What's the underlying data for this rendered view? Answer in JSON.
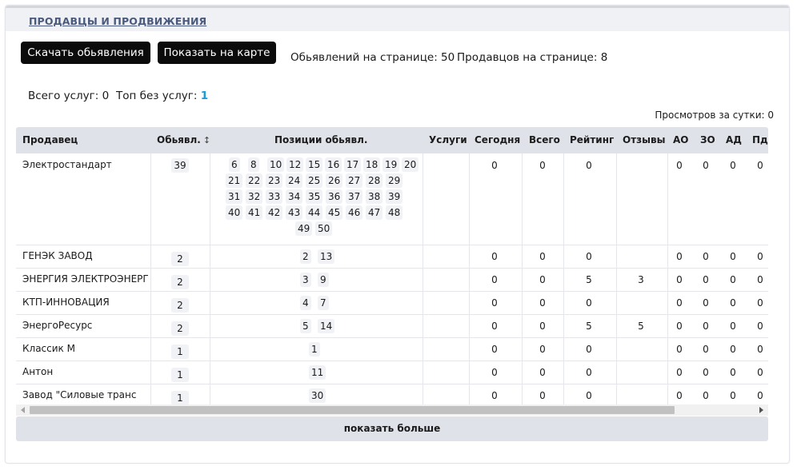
{
  "panel": {
    "title": "ПРОДАВЦЫ И ПРОДВИЖЕНИЯ"
  },
  "toolbar": {
    "download_label": "Скачать обьявления",
    "map_label": "Показать на карте",
    "ads_per_page": "Обьявлений на странице: 50",
    "sellers_per_page": "Продавцов на странице: 8"
  },
  "summary": {
    "total_services_label": "Всего услуг: 0",
    "top_without_label": "Топ без услуг: ",
    "top_without_value": "1",
    "views_per_day": "Просмотров за сутки: 0"
  },
  "table": {
    "columns": [
      "Продавец",
      "Обьявл.",
      "Позиции обьявл.",
      "Услуги",
      "Сегодня",
      "Всего",
      "Рейтинг",
      "Отзывы",
      "АО",
      "ЗО",
      "АД",
      "Пд"
    ],
    "sort_icon": "sort-updown-icon",
    "rows": [
      {
        "seller": "Электростандарт",
        "ads": "39",
        "positions": [
          "6",
          "8",
          "10",
          "12",
          "15",
          "16",
          "17",
          "18",
          "19",
          "20",
          "21",
          "22",
          "23",
          "24",
          "25",
          "26",
          "27",
          "28",
          "29",
          "31",
          "32",
          "33",
          "34",
          "35",
          "36",
          "37",
          "38",
          "39",
          "40",
          "41",
          "42",
          "43",
          "44",
          "45",
          "46",
          "47",
          "48",
          "49",
          "50"
        ],
        "services": "",
        "today": "0",
        "total": "0",
        "rating": "0",
        "reviews": "",
        "ao": "0",
        "zo": "0",
        "ad": "0",
        "pd": "0"
      },
      {
        "seller": "ГЕНЭК ЗАВОД",
        "ads": "2",
        "positions": [
          "2",
          "13"
        ],
        "services": "",
        "today": "0",
        "total": "0",
        "rating": "0",
        "reviews": "",
        "ao": "0",
        "zo": "0",
        "ad": "0",
        "pd": "0"
      },
      {
        "seller": "ЭНЕРГИЯ ЭЛЕКТРОЭНЕРГ",
        "ads": "2",
        "positions": [
          "3",
          "9"
        ],
        "services": "",
        "today": "0",
        "total": "0",
        "rating": "5",
        "reviews": "3",
        "ao": "0",
        "zo": "0",
        "ad": "0",
        "pd": "0"
      },
      {
        "seller": "КТП-ИННОВАЦИЯ",
        "ads": "2",
        "positions": [
          "4",
          "7"
        ],
        "services": "",
        "today": "0",
        "total": "0",
        "rating": "0",
        "reviews": "",
        "ao": "0",
        "zo": "0",
        "ad": "0",
        "pd": "0"
      },
      {
        "seller": "ЭнергоРесурс",
        "ads": "2",
        "positions": [
          "5",
          "14"
        ],
        "services": "",
        "today": "0",
        "total": "0",
        "rating": "5",
        "reviews": "5",
        "ao": "0",
        "zo": "0",
        "ad": "0",
        "pd": "0"
      },
      {
        "seller": "Классик М",
        "ads": "1",
        "positions": [
          "1"
        ],
        "services": "",
        "today": "0",
        "total": "0",
        "rating": "0",
        "reviews": "",
        "ao": "0",
        "zo": "0",
        "ad": "0",
        "pd": "0"
      },
      {
        "seller": "Антон",
        "ads": "1",
        "positions": [
          "11"
        ],
        "services": "",
        "today": "0",
        "total": "0",
        "rating": "0",
        "reviews": "",
        "ao": "0",
        "zo": "0",
        "ad": "0",
        "pd": "0"
      },
      {
        "seller": "Завод \"Силовые транс",
        "ads": "1",
        "positions": [
          "30"
        ],
        "services": "",
        "today": "0",
        "total": "0",
        "rating": "0",
        "reviews": "",
        "ao": "0",
        "zo": "0",
        "ad": "0",
        "pd": "0"
      }
    ]
  },
  "footer": {
    "show_more_label": "показать больше"
  }
}
